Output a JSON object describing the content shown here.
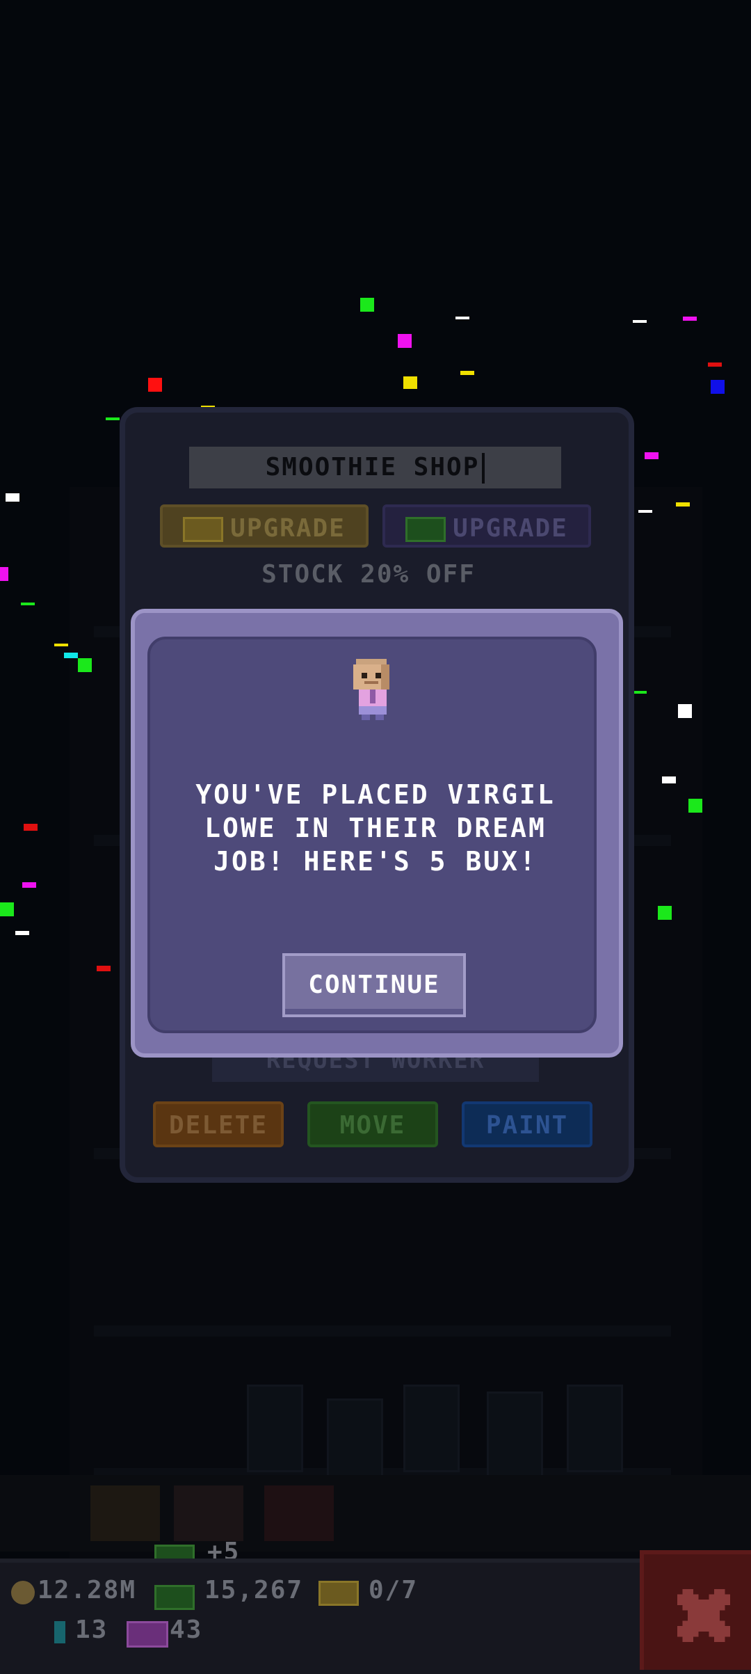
{
  "panel": {
    "shop_name": "SMOOTHIE SHOP",
    "upgrade_coins_label": "UPGRADE",
    "upgrade_bux_label": "UPGRADE",
    "stock_label": "STOCK 20% OFF",
    "request_worker_label": "REQUEST WORKER",
    "delete_label": "DELETE",
    "move_label": "MOVE",
    "paint_label": "PAINT"
  },
  "dialog": {
    "message": "YOU'VE PLACED VIRGIL LOWE IN THEIR DREAM JOB! HERE'S 5 BUX!",
    "continue_label": "CONTINUE"
  },
  "hud": {
    "bux_gain": "+5",
    "coins": "12.28M",
    "bux": "15,267",
    "golden_tickets": "0/7",
    "gems": "13",
    "vip_tickets": "43"
  },
  "icons": {
    "coin": "coin-icon",
    "bux": "bux-bill-icon",
    "golden_ticket": "golden-ticket-icon",
    "gem": "gem-icon",
    "vip_ticket": "vip-ticket-icon",
    "close": "close-icon"
  },
  "colors": {
    "dialog_frame": "#7a72a8",
    "dialog_body": "#4e4a7a",
    "button": "#77719f",
    "delete": "#5a3511",
    "move": "#1c4217",
    "paint": "#0d2c56",
    "close": "#4a1414"
  }
}
